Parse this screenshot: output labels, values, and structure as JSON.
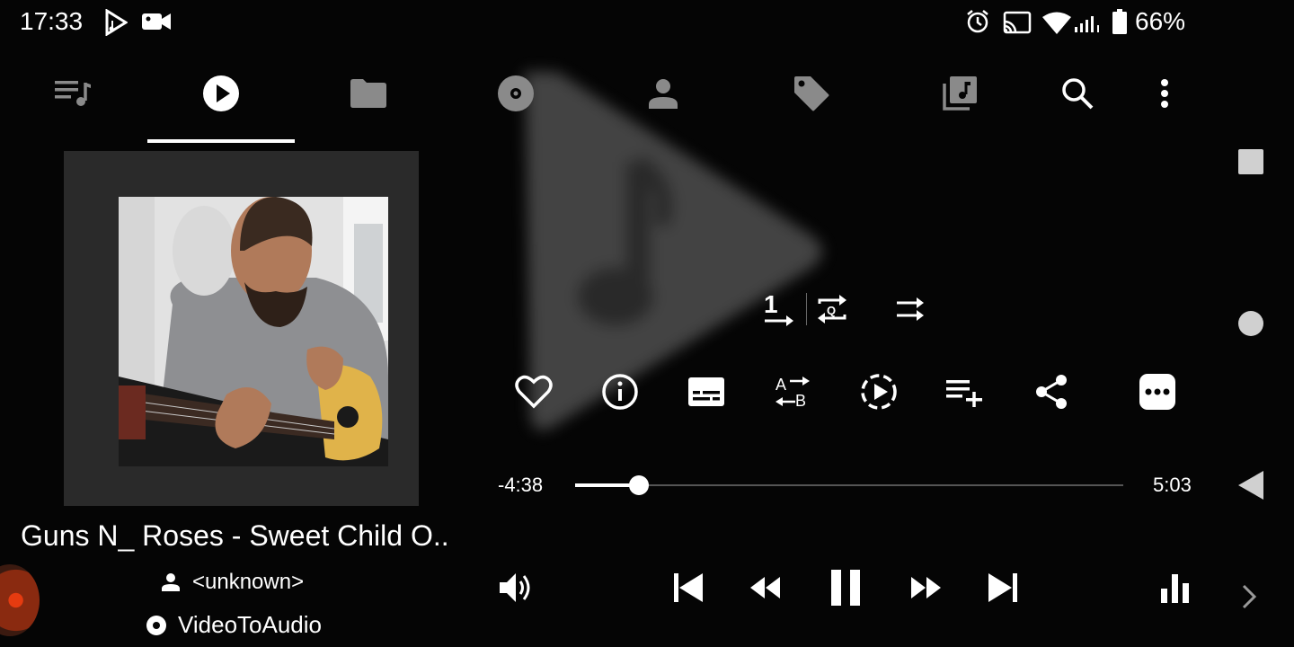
{
  "status_bar": {
    "time": "17:33",
    "battery_text": "66%",
    "icons": [
      "play-store-icon",
      "video-camera-icon",
      "alarm-icon",
      "cast-icon",
      "wifi-icon",
      "signal-icon",
      "battery-icon"
    ]
  },
  "tabs": [
    {
      "icon": "queue-icon"
    },
    {
      "icon": "now-playing-icon",
      "selected": true
    },
    {
      "icon": "folder-icon"
    },
    {
      "icon": "album-icon"
    },
    {
      "icon": "artist-icon"
    },
    {
      "icon": "genre-tag-icon"
    },
    {
      "icon": "playlists-icon"
    },
    {
      "icon": "search-icon"
    },
    {
      "icon": "overflow-menu-icon"
    }
  ],
  "playback_modes": {
    "repeat_one_label": "1",
    "repeat_queue_label": "Q"
  },
  "actions": [
    "heart-icon",
    "info-icon",
    "subtitles-icon",
    "ab-repeat-icon",
    "playback-speed-icon",
    "add-to-playlist-icon",
    "share-icon",
    "more-icon"
  ],
  "ab_repeat": {
    "a": "A",
    "b": "B"
  },
  "progress": {
    "remaining": "-4:38",
    "total": "5:03",
    "fraction": 0.117
  },
  "track": {
    "title": "Guns N_ Roses - Sweet Child O..",
    "artist": "<unknown>",
    "album": "VideoToAudio"
  },
  "colors": {
    "background": "#050505",
    "accent": "#ffffff",
    "inactive_icon": "#8a8a8a"
  }
}
